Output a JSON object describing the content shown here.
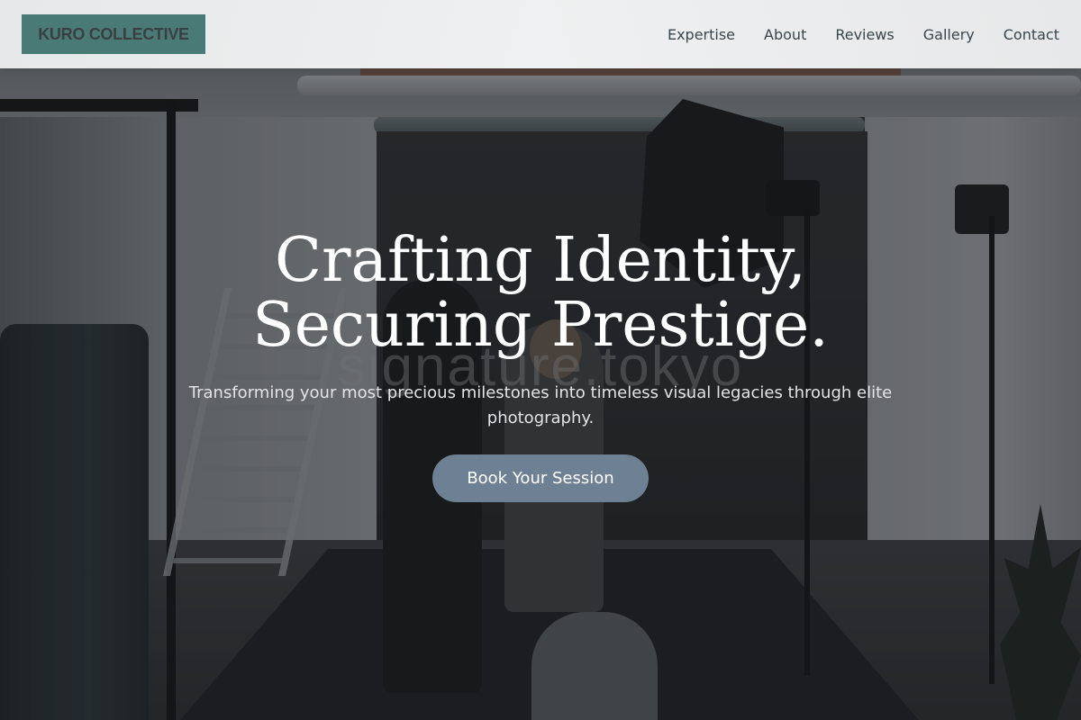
{
  "brand": {
    "logo_text": "KURO COLLECTIVE",
    "accent_color": "#4a7a76"
  },
  "nav": {
    "items": [
      {
        "label": "Expertise"
      },
      {
        "label": "About"
      },
      {
        "label": "Reviews"
      },
      {
        "label": "Gallery"
      },
      {
        "label": "Contact"
      }
    ]
  },
  "hero": {
    "title_line_1": "Crafting Identity,",
    "title_line_2": "Securing Prestige.",
    "subtitle": "Transforming your most precious milestones into timeless visual legacies through elite photography.",
    "cta_label": "Book Your Session",
    "cta_color": "#6e8194",
    "background_watermark": "signature.tokyo"
  }
}
